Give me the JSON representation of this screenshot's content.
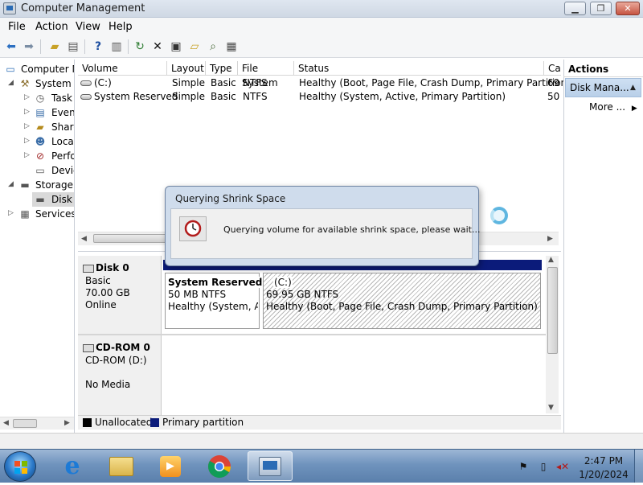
{
  "window": {
    "title": "Computer Management",
    "minimize": "▁",
    "maximize": "❐",
    "close": "✕"
  },
  "menu": [
    "File",
    "Action",
    "View",
    "Help"
  ],
  "tree": [
    {
      "label": "Computer M",
      "icon": "computer-icon"
    },
    {
      "label": "System T",
      "icon": "system-tools-icon"
    },
    {
      "label": "Task",
      "icon": "task-scheduler-icon"
    },
    {
      "label": "Even",
      "icon": "event-viewer-icon"
    },
    {
      "label": "Share",
      "icon": "shared-folders-icon"
    },
    {
      "label": "Loca",
      "icon": "local-users-icon"
    },
    {
      "label": "Perfo",
      "icon": "performance-icon"
    },
    {
      "label": "Devic",
      "icon": "device-manager-icon"
    },
    {
      "label": "Storage",
      "icon": "storage-icon"
    },
    {
      "label": "Disk",
      "icon": "disk-management-icon"
    },
    {
      "label": "Services",
      "icon": "services-icon"
    }
  ],
  "volume_table": {
    "columns": [
      "Volume",
      "Layout",
      "Type",
      "File System",
      "Status",
      "Ca"
    ],
    "rows": [
      {
        "volume": "(C:)",
        "layout": "Simple",
        "type": "Basic",
        "fs": "NTFS",
        "status": "Healthy (Boot, Page File, Crash Dump, Primary Partition)",
        "cap": "69"
      },
      {
        "volume": "System Reserved",
        "layout": "Simple",
        "type": "Basic",
        "fs": "NTFS",
        "status": "Healthy (System, Active, Primary Partition)",
        "cap": "50"
      }
    ]
  },
  "disks": {
    "disk0": {
      "name": "Disk 0",
      "kind": "Basic",
      "size": "70.00 GB",
      "state": "Online",
      "partitions": [
        {
          "name": "System Reserved",
          "size": "50 MB NTFS",
          "status": "Healthy (System, Ac"
        },
        {
          "name": "(C:)",
          "size": "69.95 GB NTFS",
          "status": "Healthy (Boot, Page File, Crash Dump, Primary Partition)"
        }
      ]
    },
    "cdrom0": {
      "name": "CD-ROM 0",
      "kind": "CD-ROM (D:)",
      "state": "No Media"
    }
  },
  "legend": [
    {
      "label": "Unallocated",
      "color": "#000000"
    },
    {
      "label": "Primary partition",
      "color": "#0b1b7a"
    }
  ],
  "actions": {
    "title": "Actions",
    "group": "Disk Mana...",
    "more": "More ..."
  },
  "dialog": {
    "title": "Querying Shrink Space",
    "message": "Querying volume for available shrink space, please wait...",
    "icon": "clock-icon"
  },
  "taskbar": {
    "apps": [
      "internet-explorer-icon",
      "file-explorer-icon",
      "media-player-icon",
      "chrome-icon",
      "computer-management-icon"
    ],
    "time": "2:47 PM",
    "date": "1/20/2024"
  }
}
